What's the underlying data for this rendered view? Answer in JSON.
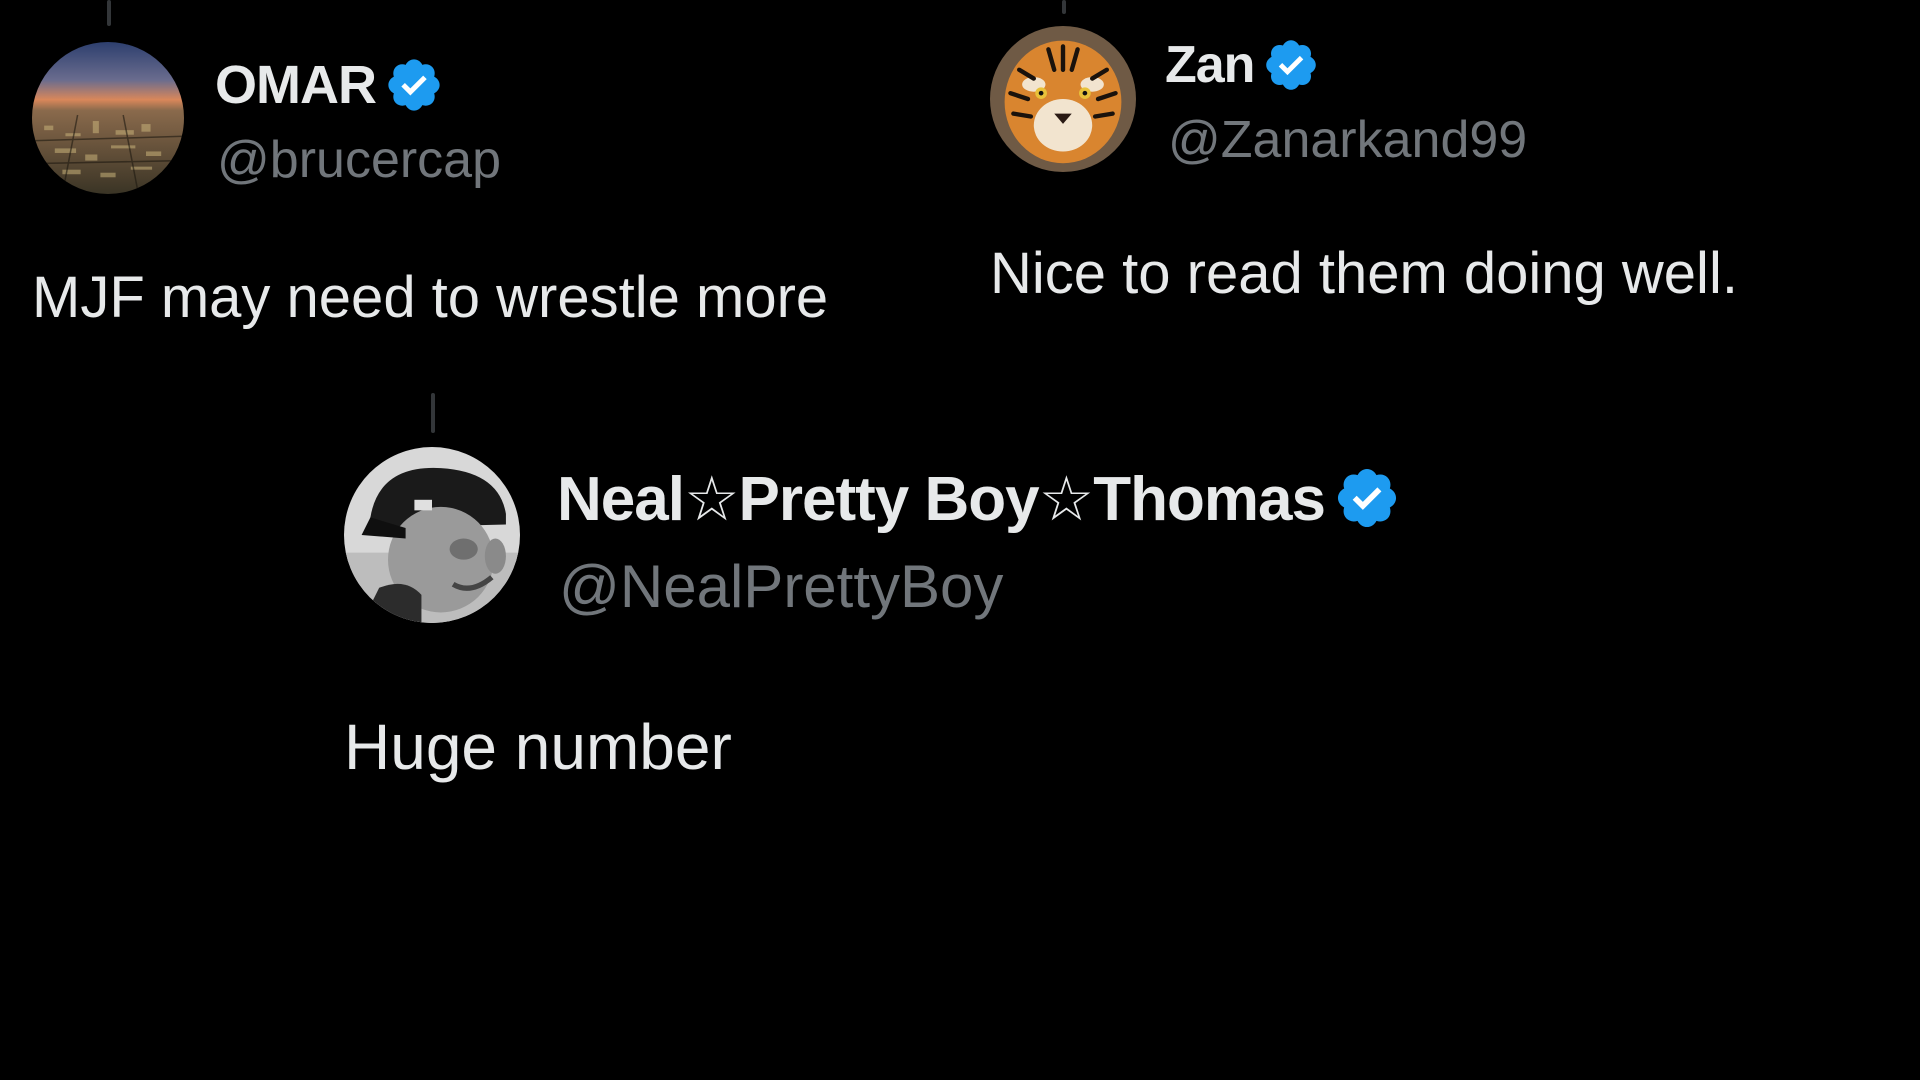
{
  "colors": {
    "background": "#000000",
    "text_primary": "#e7e9ea",
    "text_secondary": "#71767b",
    "verified_blue": "#1d9bf0",
    "thread_line": "#333639"
  },
  "tweets": [
    {
      "display_name": "OMAR",
      "handle": "@brucercap",
      "verified": true,
      "avatar_icon": "city-skyline-avatar",
      "text": "MJF may need to wrestle more"
    },
    {
      "display_name": "Zan",
      "handle": "@Zanarkand99",
      "verified": true,
      "avatar_icon": "tiger-face-avatar",
      "text": "Nice to read them doing well."
    },
    {
      "display_name": "Neal☆Pretty Boy☆Thomas",
      "handle": "@NealPrettyBoy",
      "verified": true,
      "avatar_icon": "man-in-cap-bw-avatar",
      "text": "Huge number"
    }
  ]
}
